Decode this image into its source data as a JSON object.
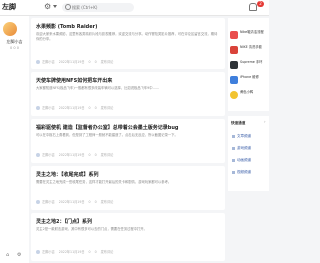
{
  "header": {
    "logo": "左脚",
    "search_placeholder": "搜索 (Ctrl+K)",
    "notification_count": "2"
  },
  "sidebar_left": {
    "username": "左脚小吉",
    "stats": "0 0 0",
    "icons": [
      "home-icon",
      "settings-icon"
    ]
  },
  "feed": [
    {
      "title": "水果频影 (Tomb Raider)",
      "summary": "欢迎大家来水果频影，这里有各类精彩片段与影视推荐，欢迎交流与分享。动作冒险类影片推荐，可在评论区留言交流，期待你的分享。",
      "meta": [
        "左脚小吉",
        "2022年11月19日",
        "0",
        "0",
        "发布评论"
      ]
    },
    {
      "title": "天使车牌使用NFS如何把车开出来",
      "summary": "大家都知道NFS(极品飞车)一般都有很多改装车辆可以选择，比如说极品飞车9中……",
      "meta": [
        "左脚小吉",
        "2022年11月19日",
        "0",
        "0",
        "发布评论"
      ]
    },
    {
      "title": "福彩驱使机 建造【监督者办公室】总带着公会墨土版务记录bug",
      "summary": "可以在中枢右上角看到，但是到了工程师一般就不能建造了。点击后无反应，所以截图记录一下。",
      "meta": [
        "左脚小吉",
        "2022年11月19日",
        "0",
        "0",
        "发布评论"
      ]
    },
    {
      "title": "灵主之地：【收尾完成】系列",
      "summary": "需要在灵主之地完成一些收尾任务，这样才能打开最后的关卡和剧情，游戏玩家都可以参考。",
      "meta": [
        "左脚小吉",
        "2022年11月19日",
        "0",
        "0",
        "发布评论"
      ]
    },
    {
      "title": "灵主之地2：【门点】系列",
      "summary": "灵主2是一款射击游戏，其中有很多可以去的门点，需要在任务过程中打开。",
      "meta": [
        "左脚小吉",
        "2022年11月19日",
        "0",
        "0",
        "发布评论"
      ]
    }
  ],
  "sidebar_right": {
    "recommendations": [
      {
        "text": "Nike鞋清洁流程",
        "color": "#e94d4d"
      },
      {
        "text": "NIKE 清洗手套",
        "color": "#d9433a"
      },
      {
        "text": "Supreme 手环",
        "color": "#2e3338"
      },
      {
        "text": "iPhone 维修",
        "color": "#3f7fdc"
      },
      {
        "text": "黄色小鸭",
        "color": "#f2c431"
      }
    ],
    "section_title": "快速通道",
    "links": [
      "文章频道",
      "游戏频道",
      "动画频道",
      "视频频道"
    ]
  }
}
